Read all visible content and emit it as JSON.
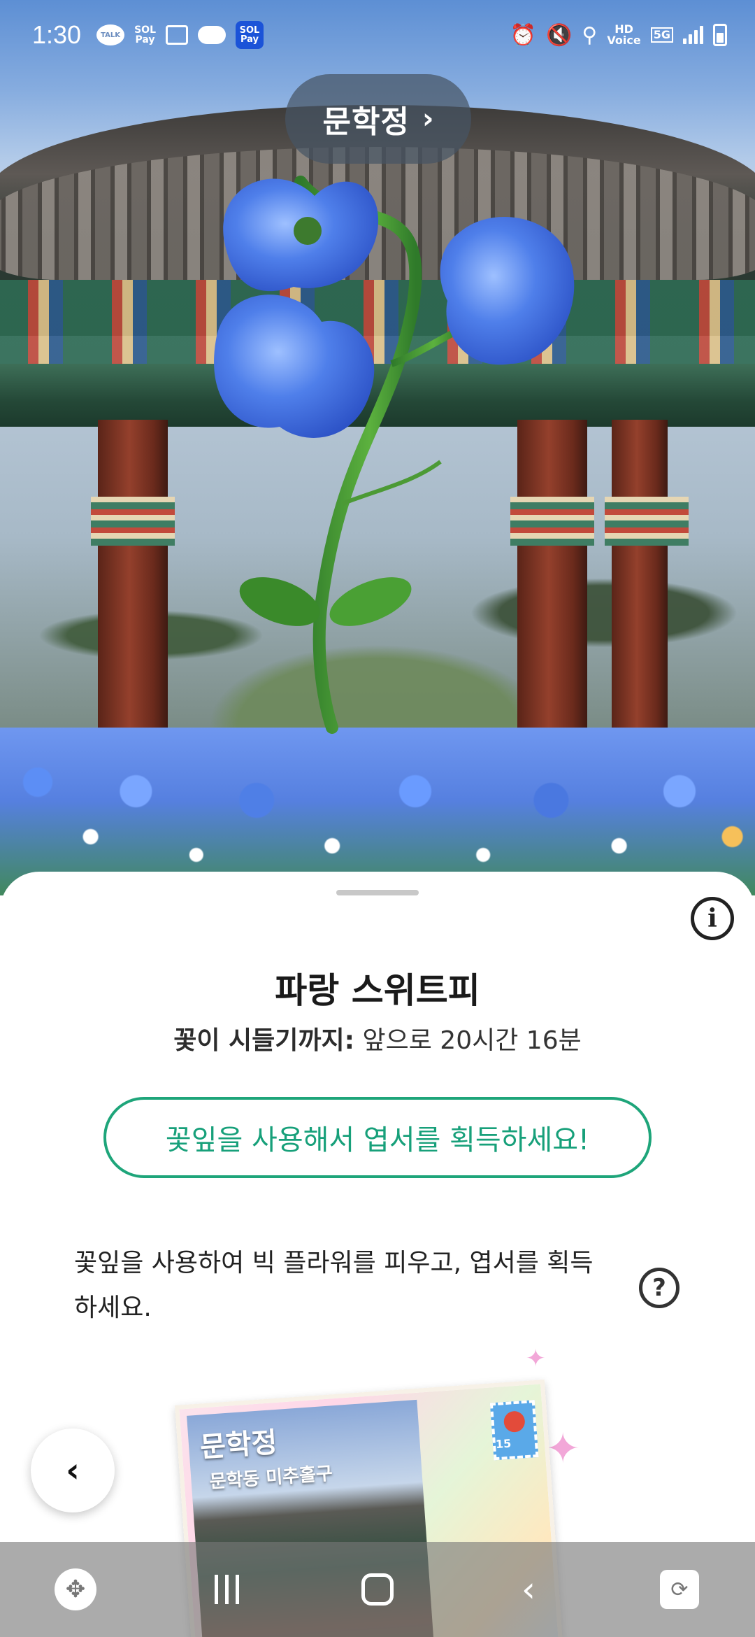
{
  "status_bar": {
    "time": "1:30",
    "icons": [
      "kakaotalk-icon",
      "sol-pay-icon",
      "gallery-icon",
      "cloud-icon",
      "sol-pay-app-icon",
      "alarm-icon",
      "mute-icon",
      "location-icon",
      "hd-voice-icon",
      "5g-icon",
      "signal-icon",
      "battery-icon"
    ],
    "talk_label": "TALK",
    "sol_label_top": "SOL",
    "sol_label_bottom": "Pay",
    "hd_top": "HD",
    "hd_bottom": "Voice",
    "network": "5G"
  },
  "location": {
    "name": "문학정",
    "chevron": "›"
  },
  "flower": {
    "name": "파랑 스위트피",
    "wilt_label": "꽃이 시들기까지:",
    "wilt_value": "앞으로 20시간 16분",
    "accent_color": "#1ea57a"
  },
  "cta": {
    "label": "꽃잎을 사용해서 엽서를 획득하세요!"
  },
  "description": {
    "text": "꽃잎을 사용하여 빅 플라워를 피우고, 엽서를 획득하세요."
  },
  "info_button": {
    "glyph": "i"
  },
  "help_button": {
    "glyph": "?"
  },
  "postcard": {
    "title": "문학정",
    "subtitle": "문학동 미추홀구",
    "stamp_number": "15"
  },
  "back_button": {
    "glyph": "‹"
  },
  "navbar": {
    "icons": [
      "game-launcher-icon",
      "recents-icon",
      "home-icon",
      "back-icon",
      "rotation-lock-icon"
    ]
  }
}
